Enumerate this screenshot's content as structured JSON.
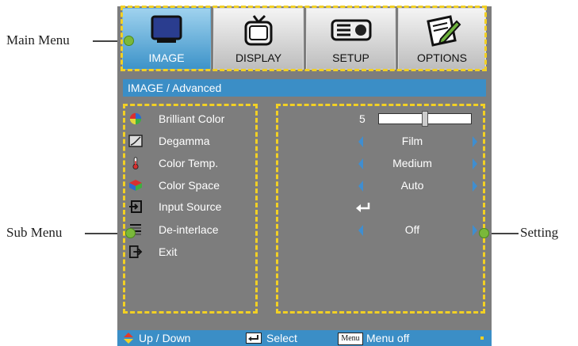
{
  "callouts": {
    "main_menu": "Main Menu",
    "sub_menu": "Sub Menu",
    "setting": "Setting"
  },
  "tabs": [
    {
      "label": "IMAGE",
      "icon": "monitor-icon",
      "active": true
    },
    {
      "label": "DISPLAY",
      "icon": "tv-icon",
      "active": false
    },
    {
      "label": "SETUP",
      "icon": "projector-icon",
      "active": false
    },
    {
      "label": "OPTIONS",
      "icon": "notepad-pencil-icon",
      "active": false
    }
  ],
  "breadcrumb": "IMAGE / Advanced",
  "items": [
    {
      "label": "Brilliant Color",
      "icon": "color-wheel-icon"
    },
    {
      "label": "Degamma",
      "icon": "gamma-curve-icon"
    },
    {
      "label": "Color Temp.",
      "icon": "thermometer-icon"
    },
    {
      "label": "Color Space",
      "icon": "color-cube-icon"
    },
    {
      "label": "Input Source",
      "icon": "input-icon"
    },
    {
      "label": "De-interlace",
      "icon": "interlace-icon"
    },
    {
      "label": "Exit",
      "icon": "exit-icon"
    }
  ],
  "settings": {
    "brilliant_color": {
      "value": "5",
      "slider_fraction": 0.5
    },
    "degamma": "Film",
    "color_temp": "Medium",
    "color_space": "Auto",
    "de_interlace": "Off"
  },
  "footer": {
    "updown": "Up / Down",
    "select": "Select",
    "menu_key": "Menu",
    "menu_off": "Menu off"
  },
  "colors": {
    "osd_bg": "#7d7d7d",
    "accent": "#3b8ec6",
    "highlight": "#f2d024",
    "callout_dot": "#7ab83a"
  }
}
